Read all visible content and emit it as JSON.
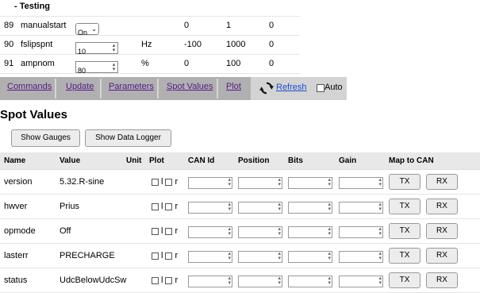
{
  "params": {
    "section_title": "- Testing",
    "rows": [
      {
        "id": "89",
        "name": "manualstart",
        "value": "On",
        "unit": "",
        "min": "0",
        "max": "1",
        "default": "0",
        "kind": "select"
      },
      {
        "id": "90",
        "name": "fslipspnt",
        "value": "10",
        "unit": "Hz",
        "min": "-100",
        "max": "1000",
        "default": "0",
        "kind": "number"
      },
      {
        "id": "91",
        "name": "ampnom",
        "value": "80",
        "unit": "%",
        "min": "0",
        "max": "100",
        "default": "0",
        "kind": "number"
      }
    ]
  },
  "nav": {
    "items": [
      "Commands",
      "Update",
      "Parameters",
      "Spot Values",
      "Plot"
    ],
    "refresh_label": "Refresh",
    "auto_label": "Auto"
  },
  "spot": {
    "title": "Spot Values",
    "show_gauges_label": "Show Gauges",
    "show_logger_label": "Show Data Logger",
    "headers": {
      "name": "Name",
      "value": "Value",
      "unit": "Unit",
      "plot": "Plot",
      "can_id": "CAN Id",
      "position": "Position",
      "bits": "Bits",
      "gain": "Gain",
      "map": "Map to CAN"
    },
    "plot_l": "l",
    "plot_r": "r",
    "tx_label": "TX",
    "rx_label": "RX",
    "rows": [
      {
        "name": "version",
        "value": "5.32.R-sine",
        "unit": ""
      },
      {
        "name": "hwver",
        "value": "Prius",
        "unit": ""
      },
      {
        "name": "opmode",
        "value": "Off",
        "unit": ""
      },
      {
        "name": "lasterr",
        "value": "PRECHARGE",
        "unit": ""
      },
      {
        "name": "status",
        "value": "UdcBelowUdcSw",
        "unit": ""
      }
    ]
  }
}
